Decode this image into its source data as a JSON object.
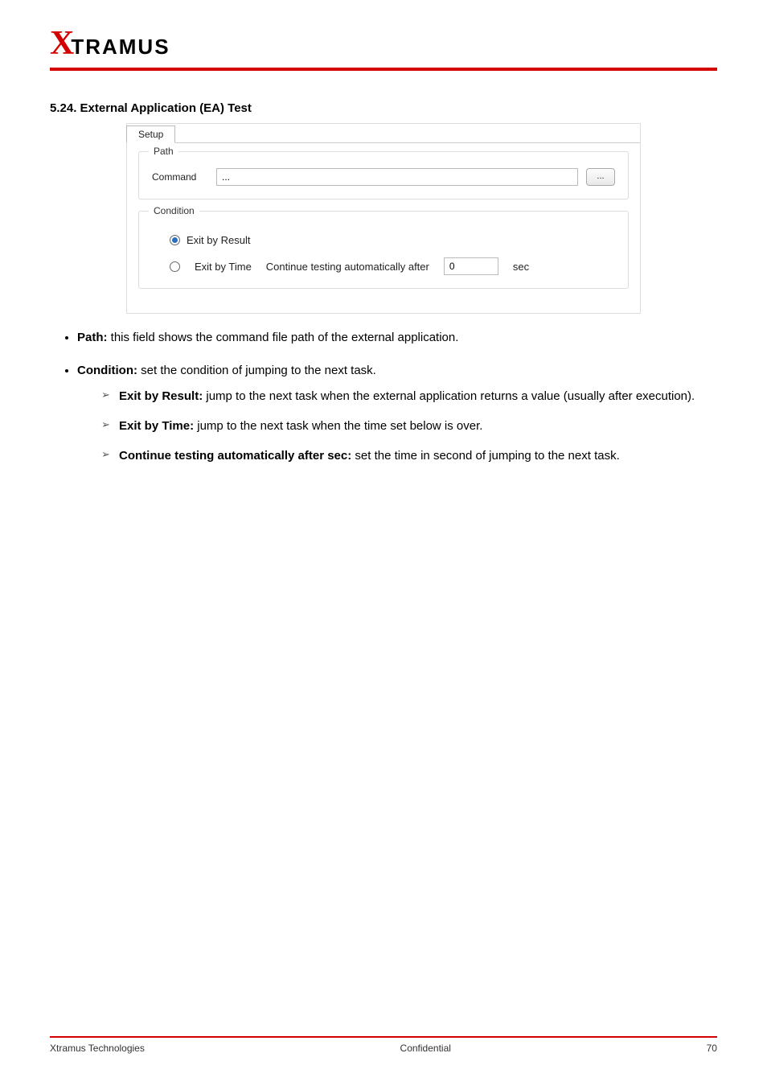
{
  "logo": {
    "x": "X",
    "rest": "TRAMUS"
  },
  "section_title": "5.24. External Application (EA) Test",
  "screenshot": {
    "tab": "Setup",
    "path_group": "Path",
    "command_label": "Command",
    "command_value": "...",
    "browse_label": "...",
    "condition_group": "Condition",
    "exit_by_result": "Exit by Result",
    "exit_by_time": "Exit by Time",
    "continue_label": "Continue testing automatically after",
    "time_value": "0",
    "sec_label": "sec"
  },
  "bullets": {
    "path": {
      "label": "Path:",
      "text": " this field shows the command file path of the external application."
    },
    "condition": {
      "label": "Condition:",
      "text": " set the condition of jumping to the next task."
    }
  },
  "arrows": {
    "a1": {
      "label": "Exit by Result:",
      "text": " jump to the next task when the external application returns a value (usually after execution)."
    },
    "a2": {
      "label": "Exit by Time:",
      "text": " jump to the next task when the time set below is over."
    },
    "a3": {
      "label": "Continue testing automatically after     sec:",
      "text": " set the time in second of jumping to the next task."
    }
  },
  "footer": {
    "left": "Xtramus Technologies",
    "mid": "Confidential",
    "right": "70"
  }
}
